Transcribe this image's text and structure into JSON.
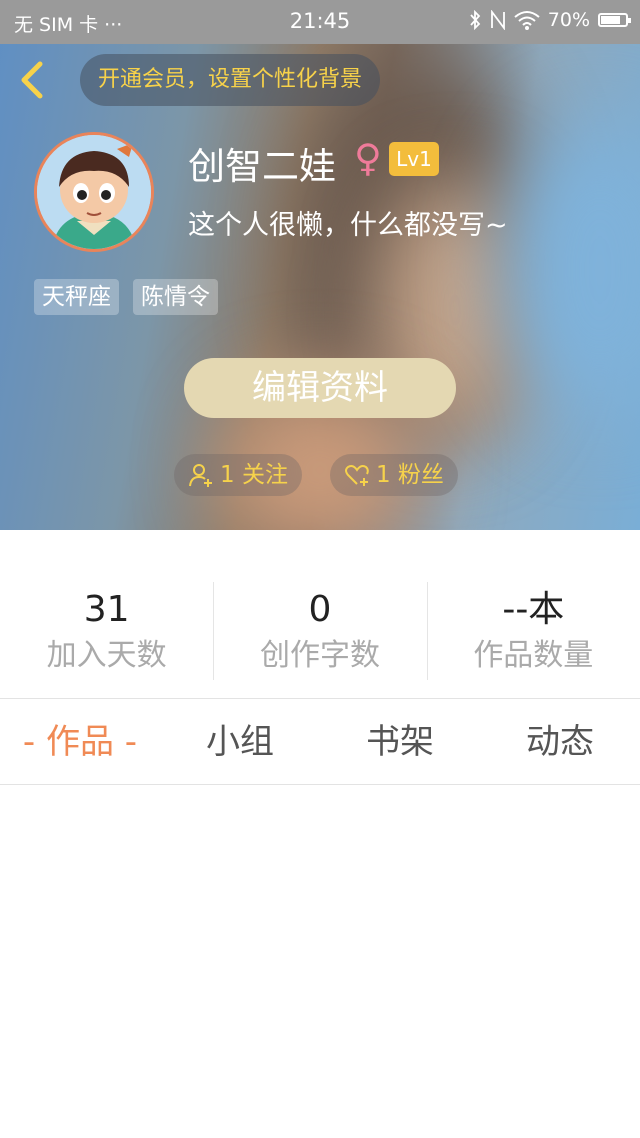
{
  "status_bar": {
    "carrier": "无 SIM 卡 ···",
    "time": "21:45",
    "battery": "70%"
  },
  "header": {
    "vip_banner": "开通会员，设置个性化背景",
    "username": "创智二娃",
    "gender_symbol": "♀",
    "level": "Lv1",
    "bio": "这个人很懒，什么都没写~",
    "tags": [
      "天秤座",
      "陈情令"
    ],
    "edit_button": "编辑资料",
    "follow_label": "1 关注",
    "fans_label": "1 粉丝"
  },
  "stats": [
    {
      "value": "31",
      "label": "加入天数"
    },
    {
      "value": "0",
      "label": "创作字数"
    },
    {
      "value": "--本",
      "label": "作品数量"
    }
  ],
  "tabs": [
    {
      "label": "- 作品 -",
      "active": true
    },
    {
      "label": "小组",
      "active": false
    },
    {
      "label": "书架",
      "active": false
    },
    {
      "label": "动态",
      "active": false
    }
  ],
  "colors": {
    "accent_orange": "#f08a55",
    "banner_yellow": "#f7d24a",
    "level_badge": "#f3bd3c",
    "gender_pink": "#ef7b9a",
    "edit_button_bg": "#e4d8b2"
  }
}
